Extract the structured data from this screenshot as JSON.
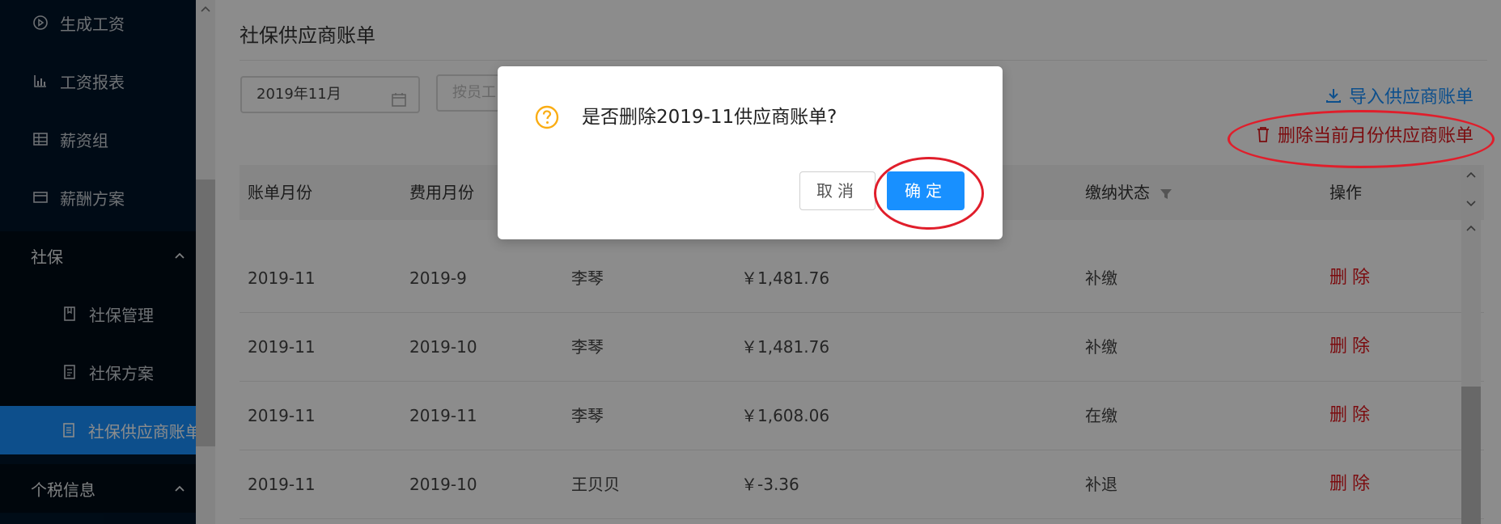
{
  "colors": {
    "sidebar_bg": "#001529",
    "accent": "#1890ff",
    "danger": "#e0161d",
    "warning": "#faad14"
  },
  "sidebar": {
    "items": [
      {
        "label": "生成工资",
        "icon": "play-circle-icon"
      },
      {
        "label": "工资报表",
        "icon": "bar-chart-icon"
      },
      {
        "label": "薪资组",
        "icon": "table-icon"
      },
      {
        "label": "薪酬方案",
        "icon": "card-icon"
      }
    ],
    "group_social": {
      "label": "社保"
    },
    "sub_items": [
      {
        "label": "社保管理",
        "icon": "book-icon"
      },
      {
        "label": "社保方案",
        "icon": "profile-icon"
      },
      {
        "label": "社保供应商账单",
        "icon": "file-text-icon"
      }
    ],
    "group_tax": {
      "label": "个税信息"
    }
  },
  "page": {
    "title": "社保供应商账单",
    "date_value": "2019年11月",
    "employee_placeholder": "按员工",
    "import_link": "导入供应商账单",
    "delete_month_link": "删除当前月份供应商账单"
  },
  "table": {
    "headers": {
      "bill_month": "账单月份",
      "fee_month": "费用月份",
      "status": "缴纳状态",
      "action": "操作"
    },
    "rows": [
      {
        "bill_month": "2019-11",
        "fee_month": "2019-9",
        "name": "李琴",
        "amount": "￥1,481.76",
        "status": "补缴",
        "action": "删除"
      },
      {
        "bill_month": "2019-11",
        "fee_month": "2019-10",
        "name": "李琴",
        "amount": "￥1,481.76",
        "status": "补缴",
        "action": "删除"
      },
      {
        "bill_month": "2019-11",
        "fee_month": "2019-11",
        "name": "李琴",
        "amount": "￥1,608.06",
        "status": "在缴",
        "action": "删除"
      },
      {
        "bill_month": "2019-11",
        "fee_month": "2019-10",
        "name": "王贝贝",
        "amount": "￥-3.36",
        "status": "补退",
        "action": "删除"
      }
    ]
  },
  "dialog": {
    "message": "是否删除2019-11供应商账单?",
    "cancel_label": "取消",
    "ok_label": "确定"
  }
}
